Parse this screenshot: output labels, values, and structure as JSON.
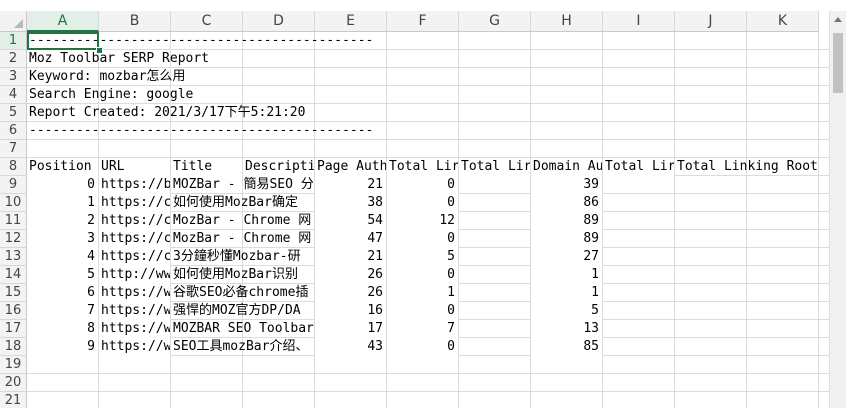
{
  "columns": [
    "A",
    "B",
    "C",
    "D",
    "E",
    "F",
    "G",
    "H",
    "I",
    "J",
    "K"
  ],
  "rows": [
    "1",
    "2",
    "3",
    "4",
    "5",
    "6",
    "7",
    "8",
    "9",
    "10",
    "11",
    "12",
    "13",
    "14",
    "15",
    "16",
    "17",
    "18",
    "19",
    "20",
    "21"
  ],
  "selected_cell": "A1",
  "report": {
    "line1": "--------------------------------------------",
    "title": "Moz Toolbar SERP Report",
    "keyword": "Keyword: mozbar怎么用",
    "engine": "Search Engine: google",
    "created": "Report Created: 2021/3/17下午5:21:20",
    "line6": "--------------------------------------------"
  },
  "headers": {
    "position": "Position",
    "url": "URL",
    "title": "Title",
    "description": "Descripti",
    "page_authority": "Page Auth",
    "total_links_1": "Total Lir",
    "total_links_2": "Total Lir",
    "domain_authority": "Domain Au",
    "total_links_3": "Total Lir",
    "total_linking_root": "Total Linking Root"
  },
  "data_rows": [
    {
      "pos": "0",
      "url": "https://b",
      "title": "MOZBar - 簡易SEO 分",
      "pa": "21",
      "tl": "0",
      "da": "39"
    },
    {
      "pos": "1",
      "url": "https://c",
      "title": "如何使用MozBar确定",
      "pa": "38",
      "tl": "0",
      "da": "86"
    },
    {
      "pos": "2",
      "url": "https://c",
      "title": "MozBar - Chrome 网",
      "pa": "54",
      "tl": "12",
      "da": "89"
    },
    {
      "pos": "3",
      "url": "https://c",
      "title": "MozBar - Chrome 网",
      "pa": "47",
      "tl": "0",
      "da": "89"
    },
    {
      "pos": "4",
      "url": "https://c",
      "title": "3分鐘秒懂Mozbar-研",
      "pa": "21",
      "tl": "5",
      "da": "27"
    },
    {
      "pos": "5",
      "url": "http://ww",
      "title": "如何使用MozBar识别",
      "pa": "26",
      "tl": "0",
      "da": "1"
    },
    {
      "pos": "6",
      "url": "https://w",
      "title": "谷歌SEO必备chrome插",
      "pa": "26",
      "tl": "1",
      "da": "1"
    },
    {
      "pos": "7",
      "url": "https://w",
      "title": "强悍的MOZ官方DP/DA",
      "pa": "16",
      "tl": "0",
      "da": "5"
    },
    {
      "pos": "8",
      "url": "https://w",
      "title": "MOZBAR SEO Toolbar",
      "pa": "17",
      "tl": "7",
      "da": "13"
    },
    {
      "pos": "9",
      "url": "https://w",
      "title": "SEO工具mozBar介绍、",
      "pa": "43",
      "tl": "0",
      "da": "85"
    }
  ]
}
